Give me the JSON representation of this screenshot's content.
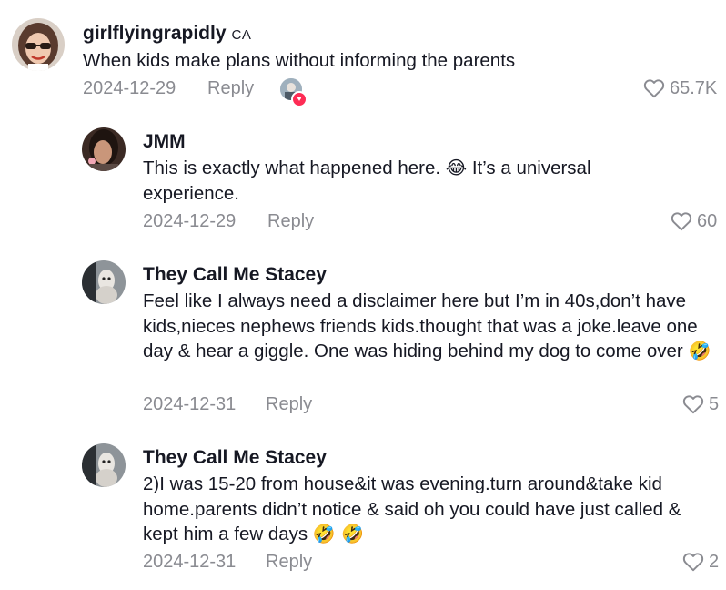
{
  "comments": [
    {
      "username": "girlflyingrapidly",
      "region": "CA",
      "text": "When kids make plans without informing the parents",
      "date": "2024-12-29",
      "reply_label": "Reply",
      "likes": "65.7K"
    },
    {
      "username": "JMM",
      "text_line1": "This is exactly what happened here.",
      "text_line1_emoji": "😂",
      "text_line1_after": "It’s a universal",
      "text_line2": "experience.",
      "date": "2024-12-29",
      "reply_label": "Reply",
      "likes": "60"
    },
    {
      "username": "They Call Me Stacey",
      "text": "Feel like I always need a disclaimer here but I’m in 40s,don’t have kids,nieces nephews friends kids.thought that was a joke.leave one day & hear a giggle. One was hiding behind my dog to come over",
      "emoji": "🤣",
      "date": "2024-12-31",
      "reply_label": "Reply",
      "likes": "5"
    },
    {
      "username": "They Call Me Stacey",
      "text": "2)I was 15-20 from house&it was evening.turn around&take kid home.parents didn’t notice & said oh you could have just called & kept him a few days",
      "emoji": "🤣 🤣",
      "date": "2024-12-31",
      "reply_label": "Reply",
      "likes": "2"
    }
  ],
  "icons": {
    "like": "heart-outline-icon",
    "creator_liked": "creator-liked-heart-icon"
  },
  "colors": {
    "text": "#161823",
    "muted": "#8a8b91",
    "accent": "#fe2c55"
  }
}
